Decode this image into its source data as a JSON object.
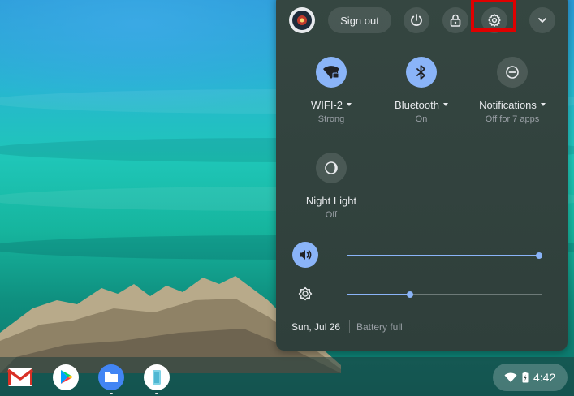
{
  "quick_settings": {
    "top_row": {
      "sign_out_label": "Sign out"
    },
    "pods": [
      {
        "label": "WIFI-2",
        "sub": "Strong",
        "icon": "wifi-locked-icon",
        "on": true,
        "has_menu": true
      },
      {
        "label": "Bluetooth",
        "sub": "On",
        "icon": "bluetooth-icon",
        "on": true,
        "has_menu": true
      },
      {
        "label": "Notifications",
        "sub": "Off for 7 apps",
        "icon": "do-not-disturb-icon",
        "on": false,
        "has_menu": true
      },
      {
        "label": "Night Light",
        "sub": "Off",
        "icon": "night-light-icon",
        "on": false,
        "has_menu": false
      }
    ],
    "sliders": {
      "volume": {
        "icon": "volume-icon",
        "level": 1.0
      },
      "brightness": {
        "icon": "brightness-icon",
        "level": 0.32
      }
    },
    "footer": {
      "date": "Sun, Jul 26",
      "battery": "Battery full"
    }
  },
  "shelf": {
    "apps": [
      {
        "name": "gmail-app",
        "icon": "gmail-icon"
      },
      {
        "name": "play-store-app",
        "icon": "play-store-icon"
      },
      {
        "name": "files-app",
        "icon": "files-icon"
      },
      {
        "name": "app-4",
        "icon": "app-icon"
      }
    ],
    "status_area": {
      "time": "4:42"
    }
  },
  "colors": {
    "accent": "#8ab4f8",
    "panel": "#2f3f3b",
    "highlight": "#e00000"
  }
}
